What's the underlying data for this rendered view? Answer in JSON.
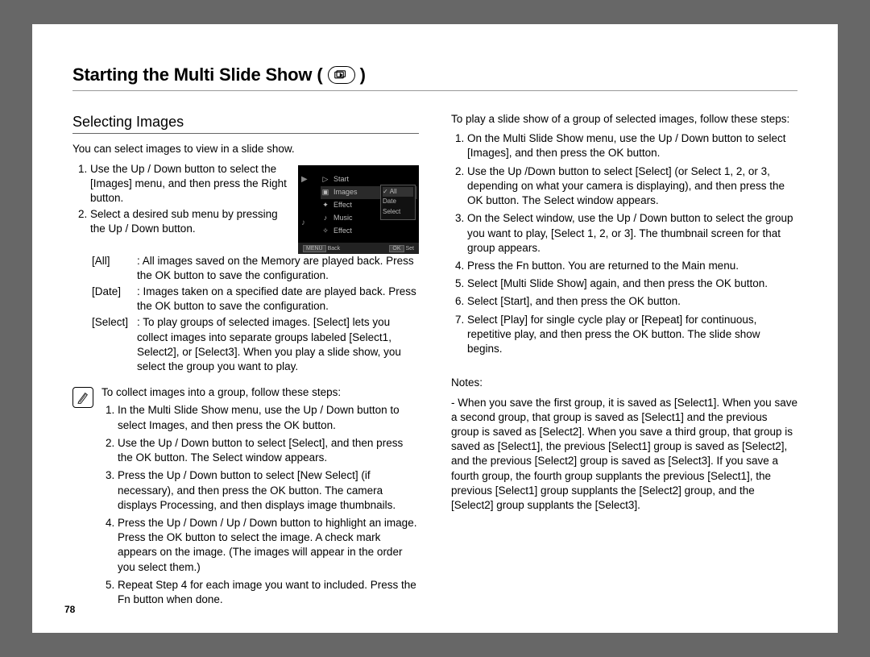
{
  "pageTitle": "Starting the Multi Slide Show",
  "titleParenOpen": "(",
  "titleParenClose": ")",
  "pageNumber": "78",
  "lcd": {
    "leftIcons": "",
    "items": [
      "Start",
      "Images",
      "Effect",
      "Music",
      "Effect"
    ],
    "submenu": [
      "All",
      "Date",
      "Select"
    ],
    "backLabel": "Back",
    "setLabel": "Set",
    "menuBtn": "MENU",
    "okBtn": "OK"
  },
  "left": {
    "subhead": "Selecting Images",
    "intro": "You can select images to view in a slide show.",
    "steps12": [
      "Use the Up / Down button to select the [Images] menu, and then press the Right button.",
      "Select a desired sub menu by pressing the Up / Down button."
    ],
    "defs": [
      {
        "term": "[All]",
        "def": ": All images saved on the Memory are played back. Press the OK button to save the configuration."
      },
      {
        "term": "[Date]",
        "def": ": Images taken on a specified date are played back. Press the OK button to save the configuration."
      },
      {
        "term": "[Select]",
        "def": ": To play groups of selected images. [Select] lets you collect images into separate groups labeled [Select1, Select2], or [Select3]. When you play a slide show, you select the group you want to play."
      }
    ],
    "noteLead": "To collect images into a group, follow these steps:",
    "noteSteps": [
      "In the Multi Slide Show menu, use the Up / Down button to select Images, and then press the OK button.",
      "Use the Up / Down button to select [Select], and then press the OK button. The Select window appears.",
      "Press the Up / Down button to select [New Select] (if necessary), and then press the OK button. The camera displays Processing, and then displays image thumbnails.",
      "Press the Up / Down / Up / Down button to highlight an image. Press the OK button to select the image. A check mark appears on the image. (The images will appear in the order you select them.)",
      "Repeat Step 4 for each image you want to included. Press the Fn button when done."
    ]
  },
  "right": {
    "intro": "To play a slide show of a group of selected images, follow these steps:",
    "steps": [
      "On the Multi Slide Show menu, use the Up / Down button to select [Images], and then press the OK button.",
      "Use the Up /Down button to select [Select] (or Select 1, 2, or 3, depending on what your camera is displaying), and then press the OK button. The Select window appears.",
      "On the Select window, use the Up / Down button to select the group you want to play, [Select 1, 2, or 3]. The thumbnail screen for that group appears.",
      "Press the Fn button. You are returned to the Main menu.",
      "Select [Multi Slide Show] again, and then press the OK button.",
      "Select [Start], and then press the OK button.",
      "Select [Play] for single cycle play or [Repeat] for continuous, repetitive play, and then press the OK button. The slide show begins."
    ],
    "notesHead": "Notes:",
    "notesBody": "- When you save the first group, it is saved as [Select1]. When you save a second group, that group is saved as [Select1] and the previous group is saved as [Select2]. When you save a third group, that group is saved as [Select1], the previous [Select1] group is saved as [Select2], and the previous [Select2] group is saved as [Select3]. If you save a fourth group, the fourth group supplants the previous [Select1], the previous [Select1] group supplants the [Select2] group, and the [Select2] group supplants the [Select3]."
  }
}
